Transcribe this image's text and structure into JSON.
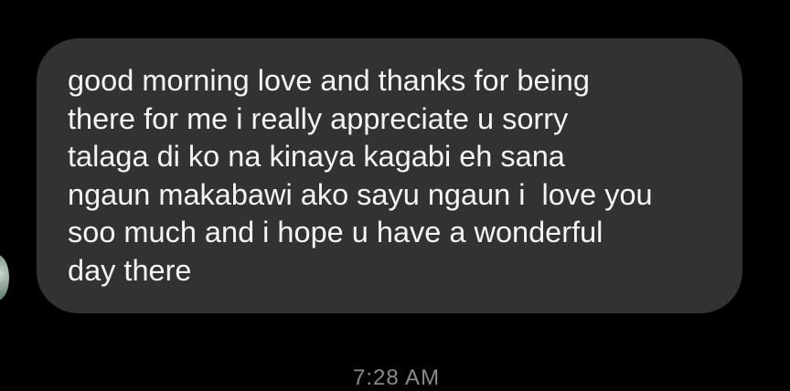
{
  "conversation": {
    "message": {
      "sender_avatar": "contact-avatar",
      "text": "good morning love and thanks for being\nthere for me i really appreciate u sorry\ntalaga di ko na kinaya kagabi eh sana\nngaun makabawi ako sayu ngaun i  love you\nsoo much and i hope u have a wonderful\nday there"
    },
    "timestamp": "7:28 AM"
  },
  "colors": {
    "background": "#000000",
    "bubble": "#323232",
    "message_text": "#f4f4f4",
    "timestamp_text": "#8a8a8a"
  }
}
